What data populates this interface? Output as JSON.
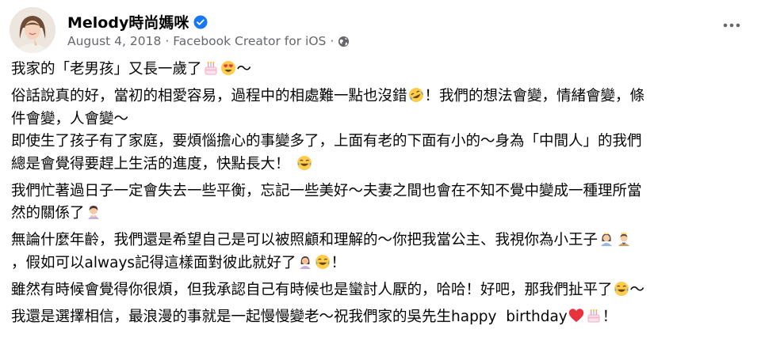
{
  "post": {
    "author": "Melody時尚媽咪",
    "verified_icon": "verified-badge-icon",
    "date": "August 4, 2018",
    "separator": "·",
    "source": "Facebook Creator for iOS",
    "audience_icon": "globe-icon",
    "more_icon": "more-options-icon"
  },
  "body": {
    "p1": {
      "text": "我家的「老男孩」又長一歲了",
      "tail": "～",
      "emoji": [
        "birthday-cake-icon",
        "heart-eyes-icon"
      ]
    },
    "p2": {
      "l1a": "俗話說真的好，當初的相愛容易，過程中的相處難一點也沒錯",
      "l1b": "！我們的想法會變，情緒會變，條",
      "l2": "件會變，人會變～",
      "l3": "即使生了孩子有了家庭，要煩惱擔心的事變多了，上面有老的下面有小的～身為「中間人」的我們",
      "l4": "總是會覺得要趕上生活的進度，快點長大！",
      "emoji": [
        "rofl-icon",
        "joy-icon"
      ]
    },
    "p3": {
      "l1": "我們忙著過日子一定會失去一些平衡，忘記一些美好～夫妻之間也會在不知不覺中變成一種理所當",
      "l2": "然的關係了",
      "emoji": [
        "person-bowing-icon"
      ]
    },
    "p4": {
      "l1": "無論什麼年齡，我們還是希望自己是可以被照顧和理解的～你把我當公主、我視你為小王子",
      "l2": "，假如可以always記得這樣面對彼此就好了",
      "l2_tail": "！",
      "emoji": [
        "princess-icon",
        "prince-icon",
        "facepalm-icon",
        "joy-icon"
      ]
    },
    "p5": {
      "text": "雖然有時候會覺得你很煩，但我承認自己有時候也是蠻討人厭的，哈哈！好吧，那我們扯平了",
      "tail": "～",
      "emoji": [
        "joy-icon"
      ]
    },
    "p6": {
      "text": "我還是選擇相信，最浪漫的事就是一起慢慢變老～祝我們家的吳先生happy  birthday",
      "tail": "！",
      "emoji": [
        "red-heart-icon",
        "birthday-cake-icon"
      ]
    }
  },
  "colors": {
    "text": "#050505",
    "meta": "#65676b",
    "verified": "#1877f2",
    "emoji_yellow": "#ffcc4d",
    "heart": "#e8323c"
  }
}
